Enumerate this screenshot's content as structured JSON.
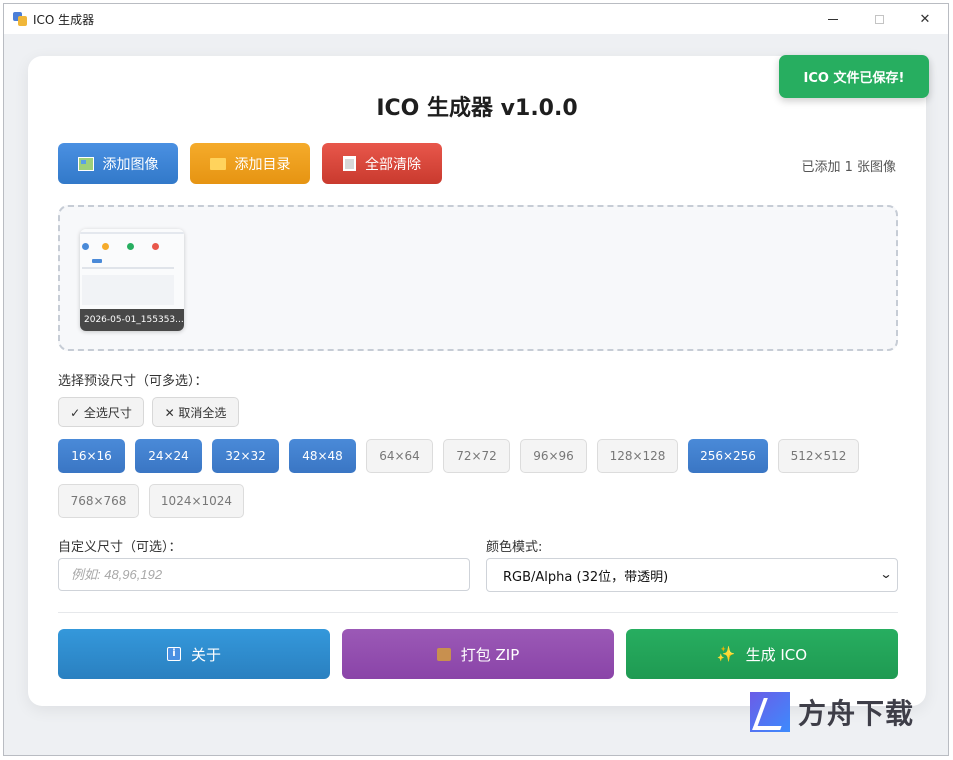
{
  "window": {
    "title": "ICO 生成器",
    "close_glyph": "✕"
  },
  "app": {
    "title": "ICO 生成器 v1.0.0"
  },
  "toast": {
    "message": "ICO 文件已保存!"
  },
  "toolbar": {
    "add_image_label": "添加图像",
    "add_folder_label": "添加目录",
    "clear_all_label": "全部清除",
    "added_count": "已添加 1 张图像"
  },
  "images": [
    {
      "name": "2026-05-01_155353..."
    }
  ],
  "presets": {
    "label": "选择预设尺寸（可多选）：",
    "select_all_label": "✓ 全选尺寸",
    "deselect_all_label": "✕ 取消全选",
    "sizes": [
      {
        "label": "16×16",
        "selected": true
      },
      {
        "label": "24×24",
        "selected": true
      },
      {
        "label": "32×32",
        "selected": true
      },
      {
        "label": "48×48",
        "selected": true
      },
      {
        "label": "64×64",
        "selected": false
      },
      {
        "label": "72×72",
        "selected": false
      },
      {
        "label": "96×96",
        "selected": false
      },
      {
        "label": "128×128",
        "selected": false
      },
      {
        "label": "256×256",
        "selected": true
      },
      {
        "label": "512×512",
        "selected": false
      },
      {
        "label": "768×768",
        "selected": false
      },
      {
        "label": "1024×1024",
        "selected": false
      }
    ]
  },
  "custom_size": {
    "label": "自定义尺寸（可选）：",
    "placeholder": "例如: 48,96,192",
    "value": ""
  },
  "color_mode": {
    "label": "颜色模式:",
    "selected": "RGB/Alpha (32位，带透明)"
  },
  "actions": {
    "about_label": "关于",
    "zip_label": "打包 ZIP",
    "generate_label": "生成 ICO"
  },
  "watermark": {
    "text": "方舟下载"
  },
  "colors": {
    "primary_blue": "#4a8ad8",
    "orange": "#f5ab2b",
    "red": "#e8574b",
    "green": "#27ae60",
    "purple": "#9b59b6",
    "about_blue": "#3498db"
  }
}
